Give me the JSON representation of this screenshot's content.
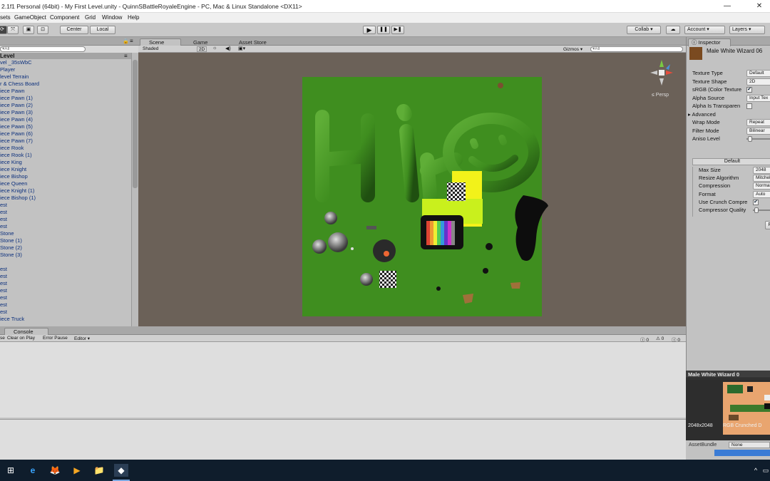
{
  "window": {
    "title": "2.1f1 Personal (64bit) - My First Level.unity - QuinnSBattleRoyaleEngine - PC, Mac & Linux Standalone <DX11>",
    "minimize": "—",
    "close": "✕"
  },
  "menu": [
    "sets",
    "GameObject",
    "Component",
    "Grid",
    "Window",
    "Help"
  ],
  "toolbar": {
    "center": "Center",
    "local": "Local",
    "play": "▶",
    "pause": "❚❚",
    "step": "▶❚",
    "collab": "Collab ▾",
    "cloud": "☁",
    "account": "Account ▾",
    "layers": "Layers ▾"
  },
  "hierarchy": {
    "search": "▾All",
    "title": "Level",
    "items": [
      "vel _35sWbC",
      " Player",
      " level  Terrain",
      "r & Chess Board",
      "iece Pawn",
      "iece Pawn (1)",
      "iece Pawn (2)",
      "iece Pawn (3)",
      "iece Pawn (4)",
      "iece Pawn (5)",
      "iece Pawn (6)",
      "iece Pawn (7)",
      "iece Rook",
      "iece Rook (1)",
      "iece King",
      "iece Knight",
      "iece Bishop",
      "iece Queen",
      "iece Knight (1)",
      "iece Bishop (1)",
      "est",
      "est",
      "est",
      "est",
      "Stone",
      "Stone (1)",
      "Stone (2)",
      "Stone (3)",
      "",
      "est",
      "est",
      "est",
      "est",
      "est",
      "est",
      "est",
      "iece Truck"
    ]
  },
  "scene": {
    "tabs": [
      "Scene",
      "Game",
      "Asset Store"
    ],
    "shading": "Shaded",
    "mode2d": "2D",
    "gizmos": "Gizmos ▾",
    "search": "▾All",
    "persp": "≤ Persp",
    "colors": {
      "background": "#6b6158",
      "terrain": "#3f8e1f",
      "yellow": "#f2f21a",
      "lime": "#c9f01d"
    }
  },
  "console": {
    "tab": "Console",
    "buttons": [
      "se",
      "Clear on Play",
      "Error Pause",
      "Editor ▾"
    ],
    "counts": [
      "0",
      "0",
      "0"
    ]
  },
  "inspector": {
    "tab": "Inspector",
    "asset_name": "Male White Wizard 06",
    "rows": [
      {
        "label": "Texture Type",
        "value": "Default"
      },
      {
        "label": "Texture Shape",
        "value": "2D"
      },
      {
        "label": "sRGB (Color Texture",
        "check": true
      },
      {
        "label": "Alpha Source",
        "value": "Input Tex"
      },
      {
        "label": "Alpha Is Transparen",
        "check": false
      },
      {
        "label": "Advanced",
        "foldout": true
      },
      {
        "label": "Wrap Mode",
        "value": "Repeat"
      },
      {
        "label": "Filter Mode",
        "value": "Bilinear"
      },
      {
        "label": "Aniso Level",
        "slider": true
      }
    ],
    "platform_tab": "Default",
    "platform_rows": [
      {
        "label": "Max Size",
        "value": "2048"
      },
      {
        "label": "Resize Algorithm",
        "value": "Mitchell"
      },
      {
        "label": "Compression",
        "value": "Normal Q"
      },
      {
        "label": "Format",
        "value": "Auto"
      },
      {
        "label": "Use Crunch Compre",
        "check": true
      },
      {
        "label": "Compressor Quality",
        "slider": true
      }
    ],
    "revert": "R"
  },
  "preview": {
    "title": "Male White Wizard 0",
    "size": "2048x2048",
    "format": "RGB Crunched D",
    "assetbundle": "AssetBundle",
    "assetbundle_value": "None"
  },
  "taskbar": {
    "icons": [
      "⊞",
      "e",
      "🦊",
      "▶",
      "📁",
      "◆"
    ],
    "tray": "^"
  }
}
